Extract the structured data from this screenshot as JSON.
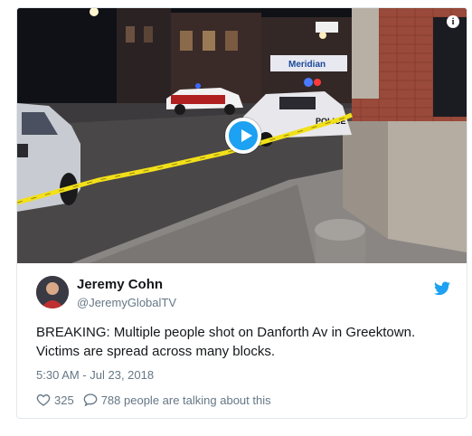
{
  "tweet": {
    "author_name": "Jeremy Cohn",
    "author_handle": "@JeremyGlobalTV",
    "text": "BREAKING: Multiple people shot on Danforth Av in Greektown. Victims are spread across many blocks.",
    "timestamp": "5:30 AM - Jul 23, 2018",
    "likes": "325",
    "conversation": "788 people are talking about this"
  },
  "media": {
    "sign_text": "Meridian",
    "police_text": "POLICE",
    "info_glyph": "i"
  },
  "icons": {
    "info": "info-icon",
    "play": "play-icon",
    "bird": "twitter-bird-icon",
    "heart": "heart-icon",
    "reply": "speech-bubble-icon"
  },
  "colors": {
    "accent": "#1da1f2",
    "text": "#14171a",
    "muted": "#657786",
    "tape": "#f2e01a"
  }
}
